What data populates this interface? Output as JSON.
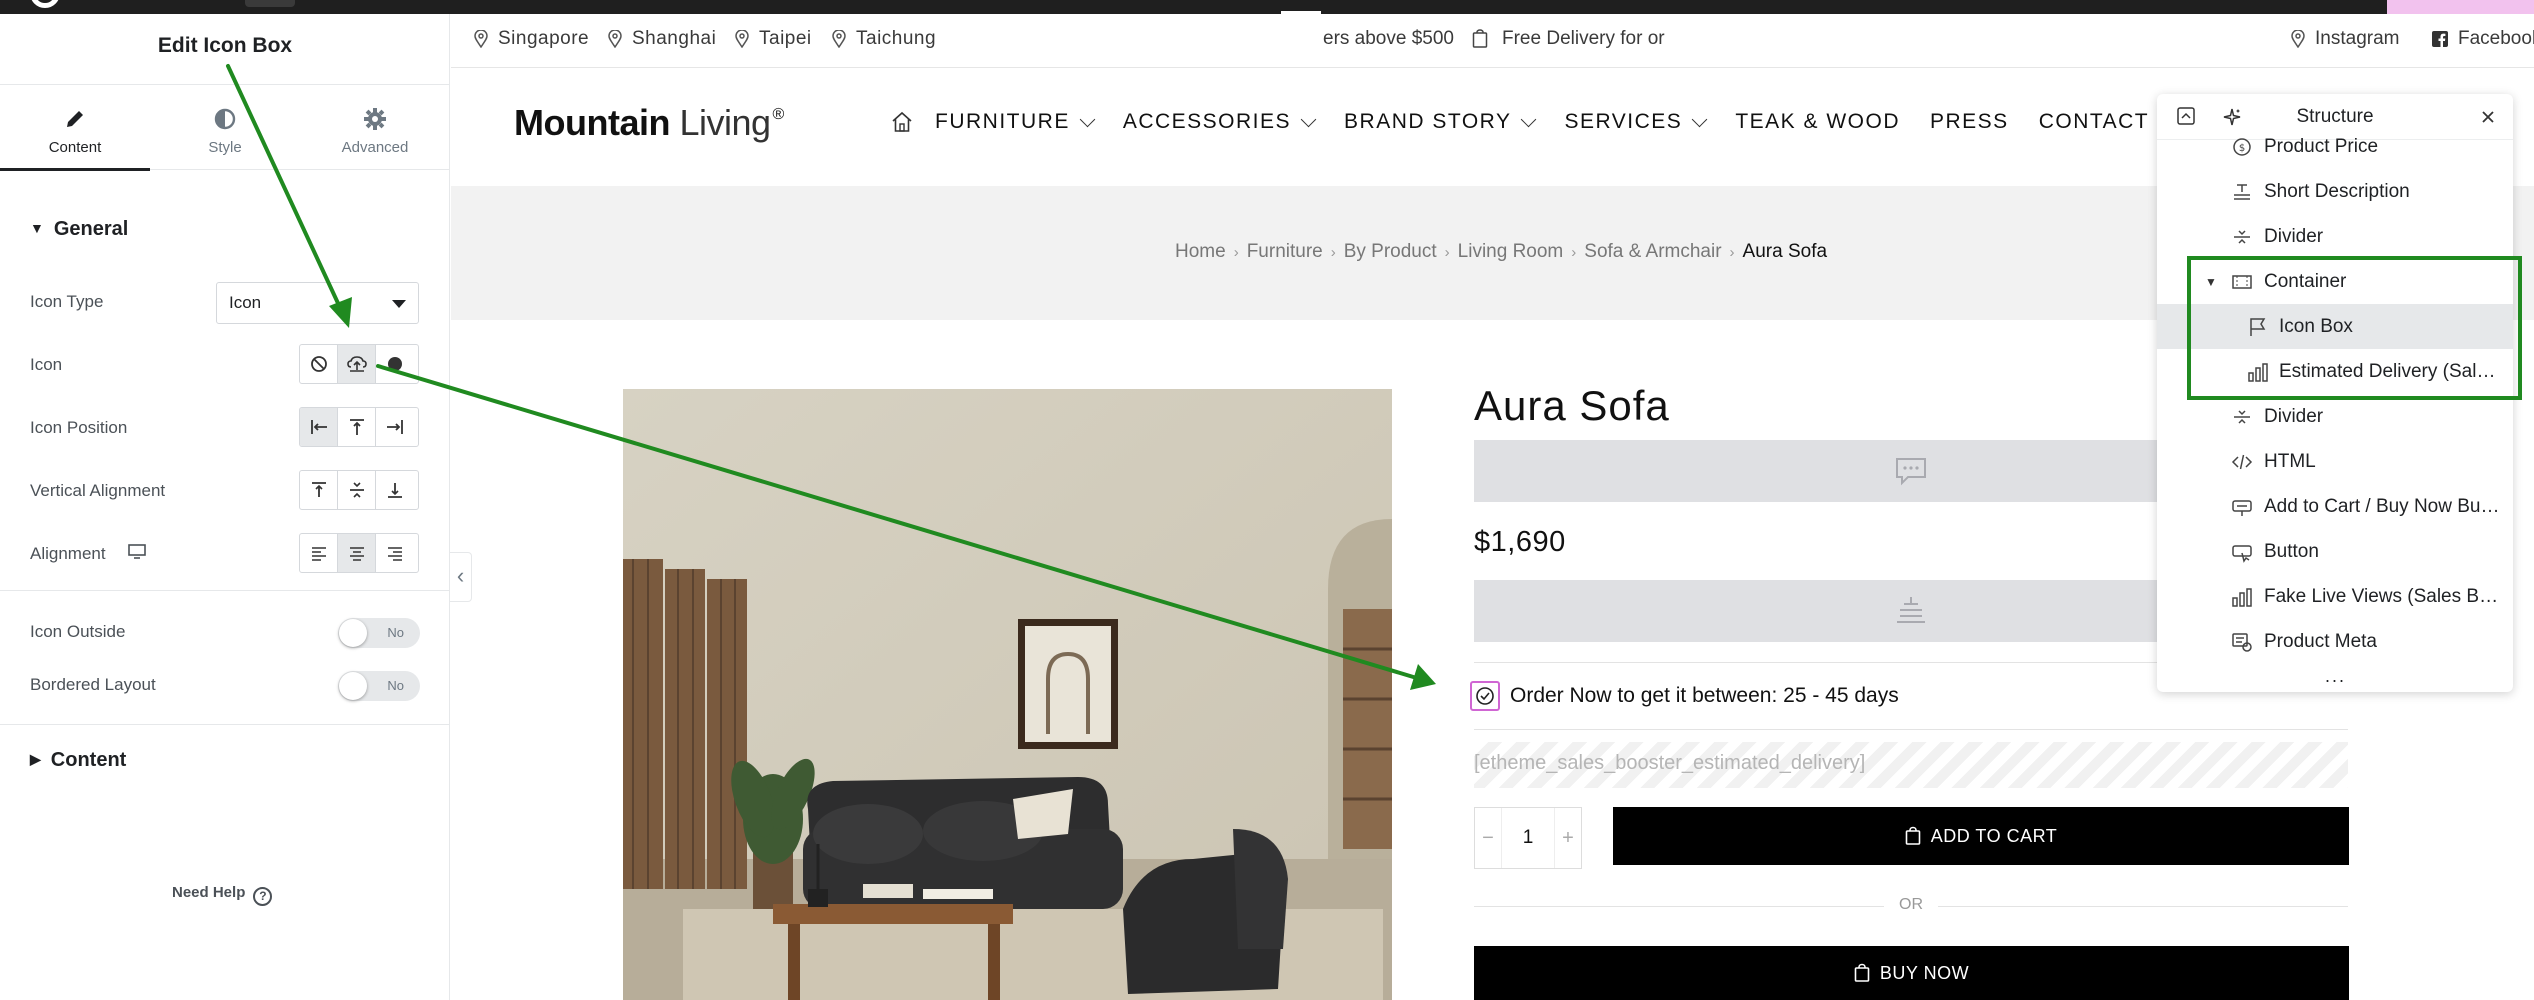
{
  "editor": {
    "title": "Edit Icon Box",
    "tabs": [
      {
        "label": "Content",
        "icon": "pencil-icon"
      },
      {
        "label": "Style",
        "icon": "contrast-icon"
      },
      {
        "label": "Advanced",
        "icon": "gear-icon"
      }
    ],
    "section_general": "General",
    "fields": {
      "icon_type_label": "Icon Type",
      "icon_type_value": "Icon",
      "icon_label": "Icon",
      "icon_position_label": "Icon Position",
      "vertical_alignment_label": "Vertical Alignment",
      "alignment_label": "Alignment",
      "icon_outside_label": "Icon Outside",
      "icon_outside_value": "No",
      "bordered_layout_label": "Bordered Layout",
      "bordered_layout_value": "No"
    },
    "section_content": "Content",
    "help": "Need Help"
  },
  "topbar": {
    "locations": [
      "Singapore",
      "Shanghai",
      "Taipei",
      "Taichung"
    ],
    "marquee_left": "ers above $500",
    "marquee_right": "Free Delivery for or",
    "social": [
      "Instagram",
      "Facebook"
    ]
  },
  "header": {
    "logo_bold": "Mountain",
    "logo_light": "Living",
    "logo_mark": "®",
    "nav": [
      {
        "label": "FURNITURE",
        "dropdown": true
      },
      {
        "label": "ACCESSORIES",
        "dropdown": true
      },
      {
        "label": "BRAND STORY",
        "dropdown": true
      },
      {
        "label": "SERVICES",
        "dropdown": true
      },
      {
        "label": "TEAK & WOOD",
        "dropdown": false
      },
      {
        "label": "PRESS",
        "dropdown": false
      },
      {
        "label": "CONTACT US",
        "dropdown": false
      }
    ]
  },
  "breadcrumb": [
    "Home",
    "Furniture",
    "By Product",
    "Living Room",
    "Sofa & Armchair"
  ],
  "breadcrumb_current": "Aura Sofa",
  "product": {
    "title": "Aura Sofa",
    "price": "$1,690",
    "delivery_text": "Order Now to get it between:  25 - 45 days",
    "shortcode": "[etheme_sales_booster_estimated_delivery]",
    "quantity": "1",
    "qty_minus": "−",
    "qty_plus": "+",
    "add_to_cart": "ADD TO CART",
    "or": "OR",
    "buy_now": "BUY NOW"
  },
  "structure": {
    "title": "Structure",
    "items": [
      {
        "label": "Product Price",
        "icon": "product-price-icon",
        "indent": 1
      },
      {
        "label": "Short Description",
        "icon": "short-description-icon",
        "indent": 1
      },
      {
        "label": "Divider",
        "icon": "divider-icon",
        "indent": 1
      },
      {
        "label": "Container",
        "icon": "container-icon",
        "indent": 1
      },
      {
        "label": "Icon Box",
        "icon": "flag-icon",
        "indent": 2
      },
      {
        "label": "Estimated Delivery (Sale…",
        "icon": "chart-icon",
        "indent": 2
      },
      {
        "label": "Divider",
        "icon": "divider-icon",
        "indent": 1
      },
      {
        "label": "HTML",
        "icon": "code-icon",
        "indent": 1
      },
      {
        "label": "Add to Cart / Buy Now But…",
        "icon": "cart-button-icon",
        "indent": 1
      },
      {
        "label": "Button",
        "icon": "button-icon",
        "indent": 1
      },
      {
        "label": "Fake Live Views (Sales Bo…",
        "icon": "chart-icon",
        "indent": 1
      },
      {
        "label": "Product Meta",
        "icon": "product-meta-icon",
        "indent": 1
      }
    ],
    "footer": "···"
  },
  "colors": {
    "annotation": "#208a20",
    "icon_outline": "#d066d3",
    "panel_selected": "#e6e8ea"
  }
}
